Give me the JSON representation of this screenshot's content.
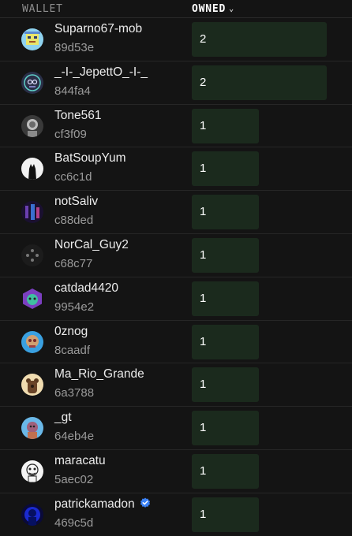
{
  "header": {
    "wallet_label": "WALLET",
    "owned_label": "OWNED",
    "sort_icon": "chevron-down-icon"
  },
  "colors": {
    "background": "#141414",
    "bar": "#1b2a1d",
    "verified": "#3b82f6"
  },
  "max_owned": 2,
  "rows": [
    {
      "name": "Suparno67-mob",
      "address": "89d53e",
      "owned": "2",
      "verified": false,
      "avatar": "pixel-face-avatar"
    },
    {
      "name": "_-I-_JepettO_-I-_",
      "address": "844fa4",
      "owned": "2",
      "verified": false,
      "avatar": "robot-avatar"
    },
    {
      "name": "Tone561",
      "address": "cf3f09",
      "owned": "1",
      "verified": false,
      "avatar": "gray-portrait-avatar"
    },
    {
      "name": "BatSoupYum",
      "address": "cc6c1d",
      "owned": "1",
      "verified": false,
      "avatar": "black-silhouette-avatar"
    },
    {
      "name": "notSaliv",
      "address": "c88ded",
      "owned": "1",
      "verified": false,
      "avatar": "dark-figure-avatar"
    },
    {
      "name": "NorCal_Guy2",
      "address": "c68c77",
      "owned": "1",
      "verified": false,
      "avatar": "dark-dots-avatar"
    },
    {
      "name": "catdad4420",
      "address": "9954e2",
      "owned": "1",
      "verified": false,
      "avatar": "hex-cat-avatar"
    },
    {
      "name": "0znog",
      "address": "8caadf",
      "owned": "1",
      "verified": false,
      "avatar": "blue-skull-avatar"
    },
    {
      "name": "Ma_Rio_Grande",
      "address": "6a3788",
      "owned": "1",
      "verified": false,
      "avatar": "bear-avatar"
    },
    {
      "name": "_gt",
      "address": "64eb4e",
      "owned": "1",
      "verified": false,
      "avatar": "ape-avatar"
    },
    {
      "name": "maracatu",
      "address": "5aec02",
      "owned": "1",
      "verified": false,
      "avatar": "sketch-avatar"
    },
    {
      "name": "patrickamadon",
      "address": "469c5d",
      "owned": "1",
      "verified": true,
      "avatar": "blue-glow-avatar"
    }
  ]
}
